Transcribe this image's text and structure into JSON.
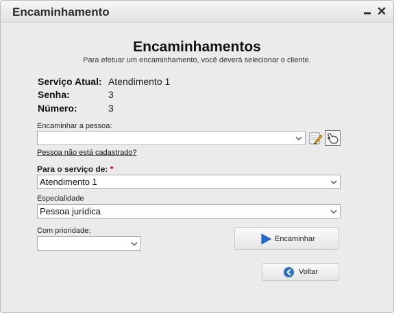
{
  "window": {
    "title": "Encaminhamento"
  },
  "header": {
    "title": "Encaminhamentos",
    "subtitle": "Para efetuar um encaminhamento, você deverá selecionar o cliente."
  },
  "info": {
    "servico_label": "Serviço Atual:",
    "servico_value": "Atendimento 1",
    "senha_label": "Senha:",
    "senha_value": "3",
    "numero_label": "Número:",
    "numero_value": "3"
  },
  "form": {
    "pessoa_label": "Encaminhar a pessoa:",
    "pessoa_value": "",
    "not_registered_link": "Pessoa não está cadastrado?",
    "servico_label": "Para o serviço de:",
    "required_mark": "*",
    "servico_value": "Atendimento 1",
    "especialidade_label": "Especialidade",
    "especialidade_value": "Pessoa jurídica",
    "prioridade_label": "Com prioridade:",
    "prioridade_value": ""
  },
  "buttons": {
    "encaminhar_label": "Encaminhar",
    "voltar_label": "Voltar"
  },
  "icons": {
    "minimize": "minimize-icon",
    "close": "close-icon",
    "edit": "edit-pencil-icon",
    "select_person": "hand-pointer-icon",
    "play": "play-icon",
    "back": "back-arrow-icon"
  },
  "colors": {
    "window_bg": "#ebebeb",
    "required": "#cc0000",
    "play_blue": "#1e6fd9"
  }
}
